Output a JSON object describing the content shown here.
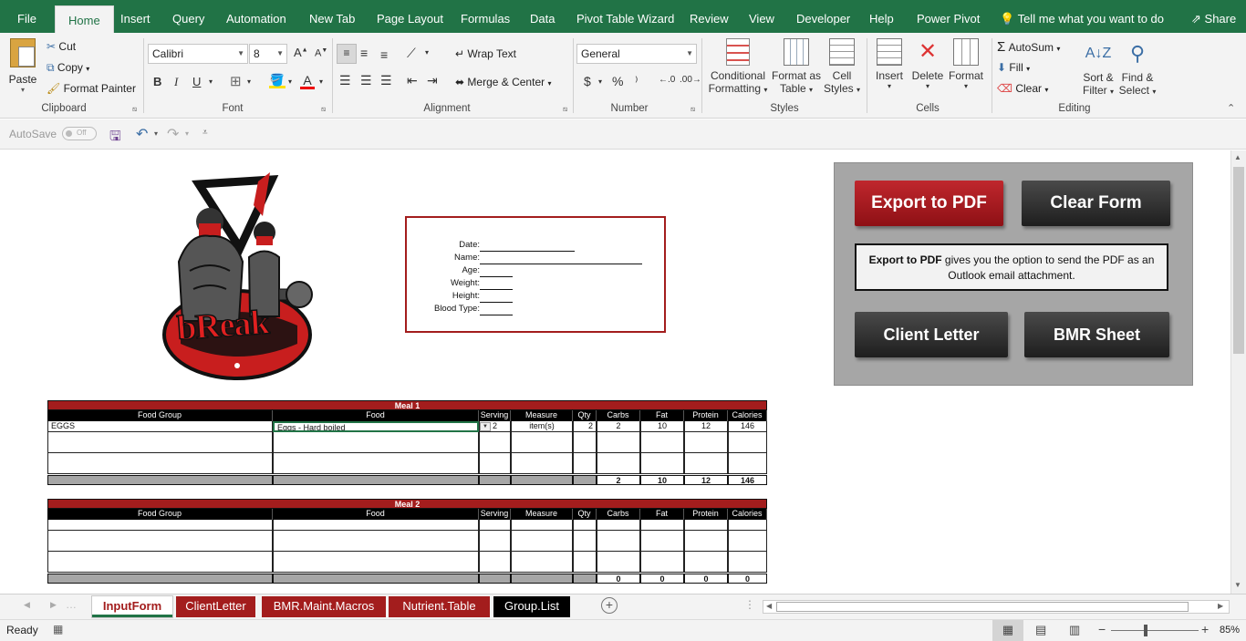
{
  "menu": {
    "tabs": [
      "File",
      "Home",
      "Insert",
      "Query",
      "Automation",
      "New Tab",
      "Page Layout",
      "Formulas",
      "Data",
      "Pivot Table Wizard",
      "Review",
      "View",
      "Developer",
      "Help",
      "Power Pivot"
    ],
    "tell_me": "Tell me what you want to do",
    "share": "Share"
  },
  "ribbon": {
    "clipboard": {
      "paste": "Paste",
      "cut": "Cut",
      "copy": "Copy",
      "format_painter": "Format Painter",
      "label": "Clipboard"
    },
    "font": {
      "name": "Calibri",
      "size": "8",
      "bold": "B",
      "italic": "I",
      "underline": "U",
      "label": "Font"
    },
    "alignment": {
      "wrap_text": "Wrap Text",
      "merge_center": "Merge & Center",
      "label": "Alignment"
    },
    "number": {
      "format": "General",
      "currency": "$",
      "percent": "%",
      "comma": "⁾",
      "label": "Number"
    },
    "styles": {
      "conditional": "Conditional",
      "conditional2": "Formatting",
      "format_as": "Format as",
      "format_as2": "Table",
      "cell": "Cell",
      "cell2": "Styles",
      "label": "Styles"
    },
    "cells": {
      "insert": "Insert",
      "delete": "Delete",
      "format": "Format",
      "label": "Cells"
    },
    "editing": {
      "autosum": "AutoSum",
      "fill": "Fill",
      "clear": "Clear",
      "sort": "Sort &",
      "sort2": "Filter",
      "find": "Find &",
      "find2": "Select",
      "label": "Editing"
    }
  },
  "qat": {
    "autosave": "AutoSave",
    "toggle": "Off"
  },
  "form": {
    "labels": [
      "Date:",
      "Name:",
      "Age:",
      "Weight:",
      "Height:",
      "Blood Type:"
    ]
  },
  "logo": {
    "text": "bReak"
  },
  "panel": {
    "export_pdf": "Export to PDF",
    "clear_form": "Clear Form",
    "info_bold": "Export to PDF",
    "info_rest": " gives you the option to send the PDF as an Outlook email attachment.",
    "client_letter": "Client Letter",
    "bmr_sheet": "BMR Sheet"
  },
  "meals": [
    {
      "title": "Meal 1",
      "headers": [
        "Food Group",
        "Food",
        "Serving",
        "Measure",
        "Qty",
        "Carbs",
        "Fat",
        "Protein",
        "Calories"
      ],
      "rows": [
        [
          "EGGS",
          "Eggs - Hard boiled",
          "2",
          "item(s)",
          "2",
          "2",
          "10",
          "12",
          "146"
        ],
        [
          "",
          "",
          "",
          "",
          "",
          "",
          "",
          "",
          ""
        ],
        [
          "",
          "",
          "",
          "",
          "",
          "",
          "",
          "",
          ""
        ],
        [
          "",
          "",
          "",
          "",
          "",
          "",
          "",
          "",
          ""
        ],
        [
          "",
          "",
          "",
          "",
          "",
          "",
          "",
          "",
          ""
        ]
      ],
      "totals": [
        "",
        "",
        "",
        "",
        "",
        "2",
        "10",
        "12",
        "146"
      ]
    },
    {
      "title": "Meal 2",
      "headers": [
        "Food Group",
        "Food",
        "Serving",
        "Measure",
        "Qty",
        "Carbs",
        "Fat",
        "Protein",
        "Calories"
      ],
      "rows": [
        [
          "",
          "",
          "",
          "",
          "",
          "",
          "",
          "",
          ""
        ],
        [
          "",
          "",
          "",
          "",
          "",
          "",
          "",
          "",
          ""
        ],
        [
          "",
          "",
          "",
          "",
          "",
          "",
          "",
          "",
          ""
        ],
        [
          "",
          "",
          "",
          "",
          "",
          "",
          "",
          "",
          ""
        ],
        [
          "",
          "",
          "",
          "",
          "",
          "",
          "",
          "",
          ""
        ]
      ],
      "totals": [
        "",
        "",
        "",
        "",
        "",
        "0",
        "0",
        "0",
        "0"
      ]
    }
  ],
  "sheet_tabs": [
    {
      "name": "InputForm",
      "bg": "#ffffff",
      "fg": "#a31d1d",
      "active": true
    },
    {
      "name": "ClientLetter",
      "bg": "#a31d1d",
      "fg": "#ffffff",
      "active": false
    },
    {
      "name": "BMR.Maint.Macros",
      "bg": "#a31d1d",
      "fg": "#ffffff",
      "active": false
    },
    {
      "name": "Nutrient.Table",
      "bg": "#a31d1d",
      "fg": "#ffffff",
      "active": false
    },
    {
      "name": "Group.List",
      "bg": "#000000",
      "fg": "#ffffff",
      "active": false
    }
  ],
  "status": {
    "ready": "Ready",
    "zoom": "85%"
  },
  "colors": {
    "excel_green": "#217346",
    "meal_red": "#a31d1d",
    "panel_gray": "#a6a6a6"
  }
}
